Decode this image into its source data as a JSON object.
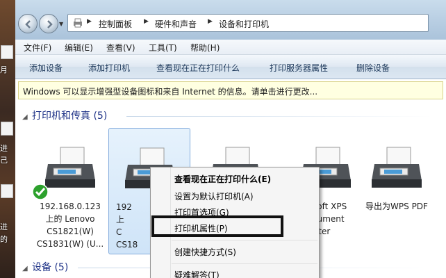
{
  "desktop": {
    "labels": [
      "月",
      "进",
      "己",
      "进",
      "的"
    ]
  },
  "address": {
    "breadcrumbs": [
      "控制面板",
      "硬件和声音",
      "设备和打印机"
    ]
  },
  "menu": [
    "文件(F)",
    "编辑(E)",
    "查看(V)",
    "工具(T)",
    "帮助(H)"
  ],
  "toolbar": [
    "添加设备",
    "添加打印机",
    "查看现在正在打印什么",
    "打印服务器属性",
    "删除设备"
  ],
  "infobar": "Windows 可以显示增强型设备图标和来自 Internet 的信息。请单击进行更改...",
  "groups": {
    "printers": {
      "title": "打印机和传真",
      "count": "(5)"
    },
    "devices": {
      "title": "设备",
      "count": "(5)"
    }
  },
  "printers": [
    {
      "label": "192.168.0.123\n上的 Lenovo\nCS1821(W)\nCS1831(W) (U...",
      "default": true
    },
    {
      "label": "192\n上\nC\nCS18",
      "selected": true
    },
    {
      "label": ""
    },
    {
      "label": "soft XPS\ncument\nriter"
    },
    {
      "label": "导出为WPS PDF"
    }
  ],
  "context_menu": [
    {
      "label": "查看现在正在打印什么(E)",
      "bold": true
    },
    {
      "label": "设置为默认打印机(A)"
    },
    {
      "label": "打印首选项(G)"
    },
    {
      "label": "打印机属性(P)"
    },
    {
      "label": "创建快捷方式(S)"
    },
    {
      "label": "疑难解答(T)"
    }
  ],
  "colors": {
    "accent": "#1e3287",
    "selection": "#cfe4f8",
    "highlight_border": "#111111",
    "default_check": "#2da12d"
  }
}
